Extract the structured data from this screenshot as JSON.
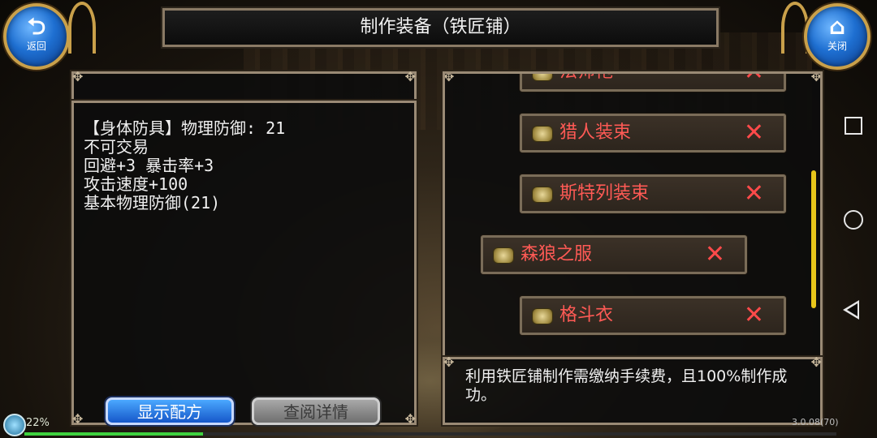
{
  "window": {
    "title": "制作装备（铁匠铺）"
  },
  "corner_buttons": {
    "back": {
      "label": "返回",
      "glyph": "⮌",
      "icon": "back-arrow-icon"
    },
    "close": {
      "label": "关闭",
      "glyph": "⌂",
      "icon": "home-icon"
    }
  },
  "description": {
    "lines": [
      "【身体防具】物理防御: 21",
      "不可交易",
      "回避+3 暴击率+3",
      "攻击速度+100",
      "基本物理防御(21)"
    ]
  },
  "recipe_list": {
    "items": [
      {
        "name": "法师袍",
        "icon": "scroll-icon",
        "remove_glyph": "✕"
      },
      {
        "name": "猎人装束",
        "icon": "scroll-icon",
        "remove_glyph": "✕"
      },
      {
        "name": "斯特列装束",
        "icon": "scroll-icon",
        "remove_glyph": "✕"
      },
      {
        "name": "森狼之服",
        "icon": "scroll-icon",
        "remove_glyph": "✕",
        "selected": true
      },
      {
        "name": "格斗衣",
        "icon": "scroll-icon",
        "remove_glyph": "✕"
      }
    ]
  },
  "note": {
    "text": "利用铁匠铺制作需缴纳手续费，且100%制作成功。"
  },
  "buttons": {
    "show_recipe": "显示配方",
    "view_detail": "查阅详情"
  },
  "status": {
    "battery": "22%",
    "version": "3.0.08(70)"
  },
  "colors": {
    "accent_gold": "#c9a04a",
    "item_text": "#ff5a55",
    "primary_button": "#1e6fd1",
    "scrollbar": "#e8c61a"
  }
}
